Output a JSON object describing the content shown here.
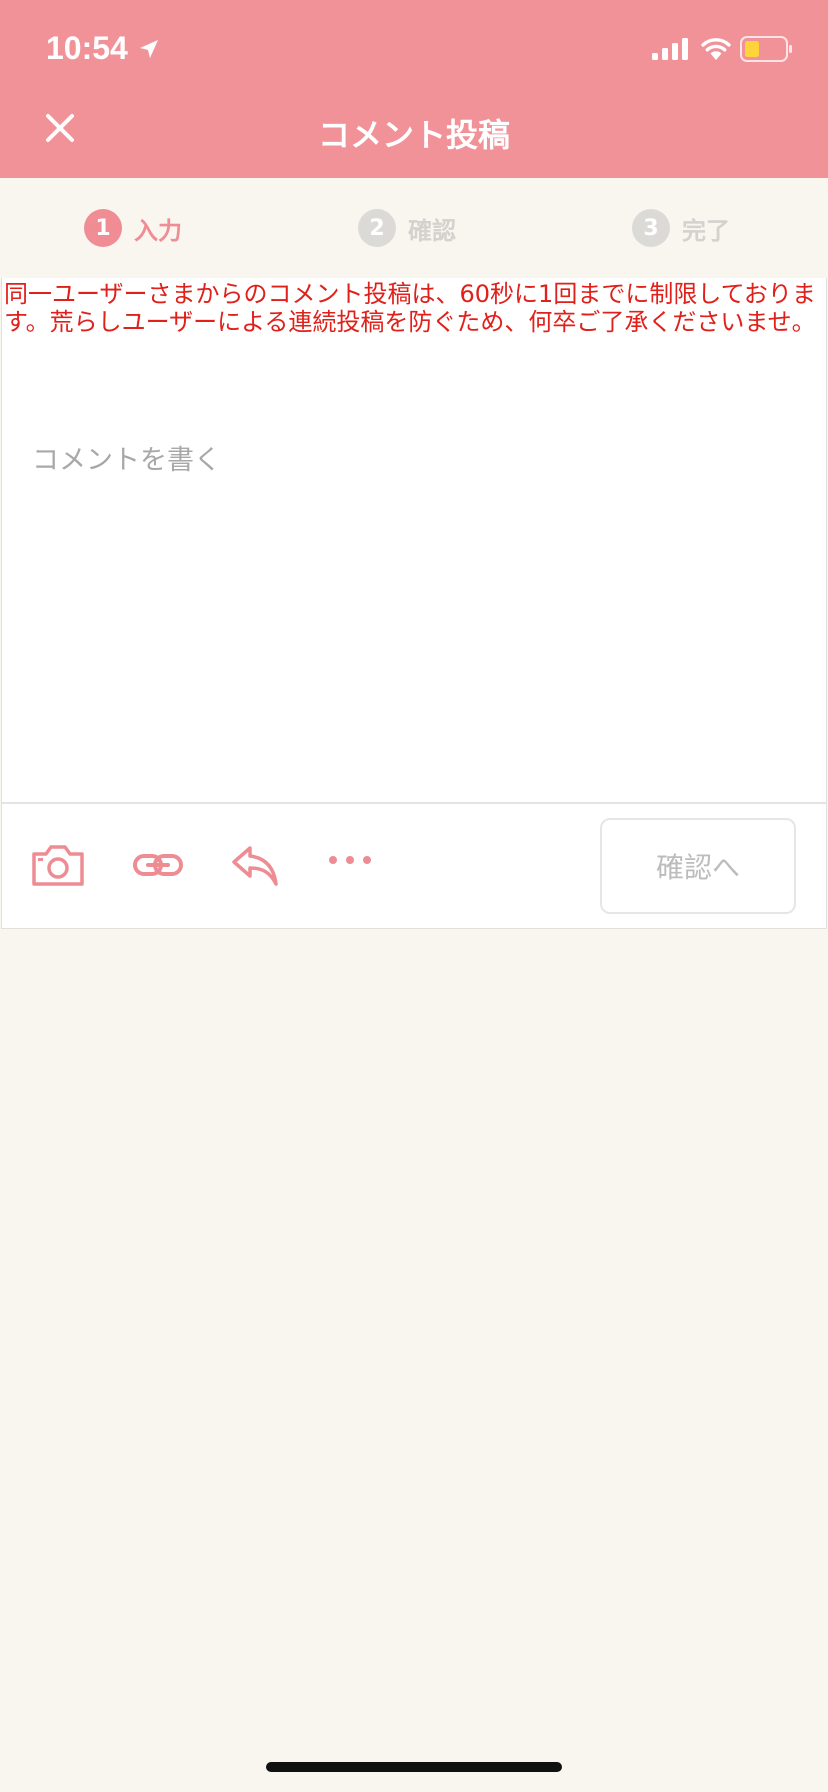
{
  "status_bar": {
    "time": "10:54"
  },
  "header": {
    "title": "コメント投稿"
  },
  "steps": [
    {
      "number": "1",
      "label": "入力",
      "active": true
    },
    {
      "number": "2",
      "label": "確認",
      "active": false
    },
    {
      "number": "3",
      "label": "完了",
      "active": false
    }
  ],
  "compose": {
    "notice": "同一ユーザーさまからのコメント投稿は、60秒に1回までに制限しております。荒らしユーザーによる連続投稿を防ぐため、何卒ご了承くださいませ。",
    "placeholder": "コメントを書く",
    "value": ""
  },
  "toolbar": {
    "icons": [
      "camera-icon",
      "link-icon",
      "reply-icon",
      "more-icon"
    ],
    "confirm_label": "確認へ"
  },
  "colors": {
    "header": "#f19298",
    "accent": "#f08c94",
    "notice": "#e0201a",
    "background": "#f9f5ef"
  }
}
